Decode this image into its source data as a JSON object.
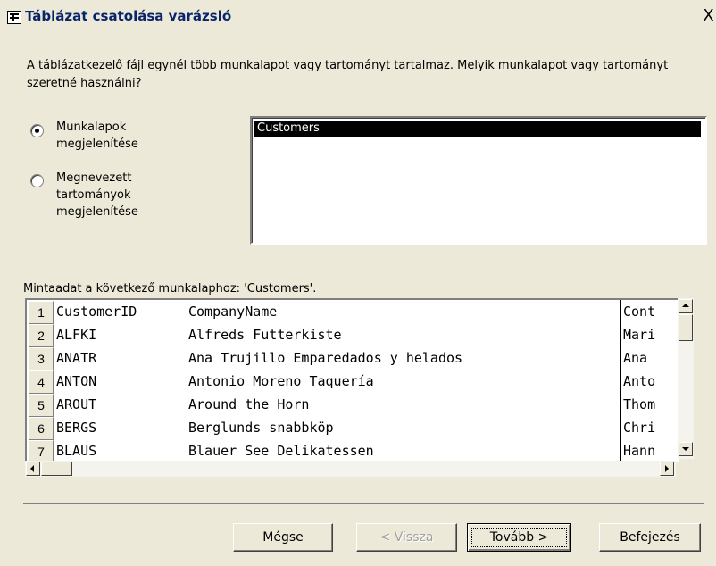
{
  "window": {
    "title": "Táblázat csatolása varázsló",
    "close_glyph": "X",
    "icon": "table-icon"
  },
  "instructions": "A táblázatkezelő fájl egynél több munkalapot vagy tartományt tartalmaz. Melyik munkalapot vagy tartományt szeretné használni?",
  "options": [
    {
      "label_line1": "Munkalapok",
      "label_line2": "megjelenítése",
      "label_line3": "",
      "checked": true
    },
    {
      "label_line1": "Megnevezett",
      "label_line2": "tartományok",
      "label_line3": "megjelenítése",
      "checked": false
    }
  ],
  "sheets": [
    "Customers"
  ],
  "sample_caption": "Mintaadat a következő munkalaphoz: 'Customers'.",
  "sample_rows": [
    {
      "n": "1",
      "a": "CustomerID",
      "b": "CompanyName",
      "c": "Cont"
    },
    {
      "n": "2",
      "a": "ALFKI",
      "b": "Alfreds Futterkiste",
      "c": "Mari"
    },
    {
      "n": "3",
      "a": "ANATR",
      "b": "Ana Trujillo Emparedados y helados",
      "c": "Ana"
    },
    {
      "n": "4",
      "a": "ANTON",
      "b": "Antonio Moreno Taquería",
      "c": "Anto"
    },
    {
      "n": "5",
      "a": "AROUT",
      "b": "Around the Horn",
      "c": "Thom"
    },
    {
      "n": "6",
      "a": "BERGS",
      "b": "Berglunds snabbköp",
      "c": "Chri"
    },
    {
      "n": "7",
      "a": "BLAUS",
      "b": "Blauer See Delikatessen",
      "c": "Hann"
    }
  ],
  "buttons": {
    "cancel": "Mégse",
    "back": "< Vissza",
    "next": "Tovább >",
    "finish": "Befejezés"
  }
}
